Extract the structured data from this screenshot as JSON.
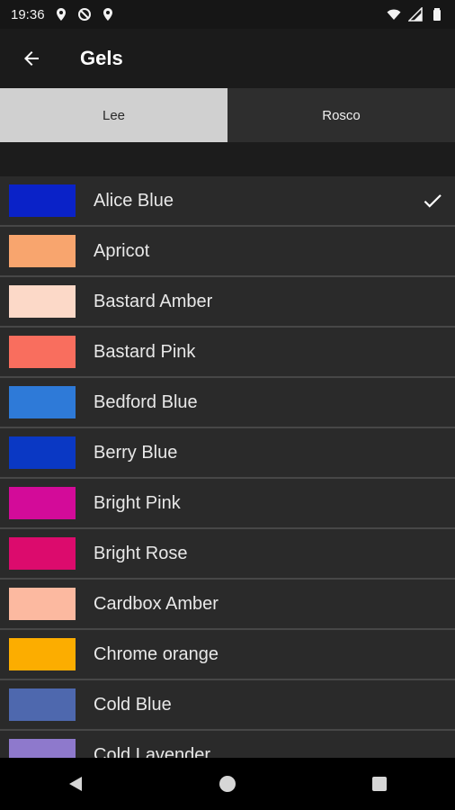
{
  "status_bar": {
    "time": "19:36",
    "icons_left": [
      "location-icon",
      "do-not-disturb-icon",
      "location-icon"
    ],
    "icons_right": [
      "wifi-icon",
      "signal-icon",
      "battery-icon"
    ]
  },
  "app_bar": {
    "title": "Gels",
    "back_icon": "arrow-left-icon"
  },
  "tabs": [
    {
      "label": "Lee",
      "selected": true
    },
    {
      "label": "Rosco",
      "selected": false
    }
  ],
  "gels": [
    {
      "name": "Alice Blue",
      "color": "#0a22c8",
      "selected": true
    },
    {
      "name": "Apricot",
      "color": "#f8a56e",
      "selected": false
    },
    {
      "name": "Bastard Amber",
      "color": "#fcd9c8",
      "selected": false
    },
    {
      "name": "Bastard Pink",
      "color": "#f96e5e",
      "selected": false
    },
    {
      "name": "Bedford Blue",
      "color": "#2e7ad8",
      "selected": false
    },
    {
      "name": "Berry Blue",
      "color": "#0a38c4",
      "selected": false
    },
    {
      "name": "Bright Pink",
      "color": "#d30b99",
      "selected": false
    },
    {
      "name": "Bright Rose",
      "color": "#dc0b6d",
      "selected": false
    },
    {
      "name": "Cardbox Amber",
      "color": "#fcb9a0",
      "selected": false
    },
    {
      "name": "Chrome orange",
      "color": "#fcad00",
      "selected": false
    },
    {
      "name": "Cold Blue",
      "color": "#4e68ae",
      "selected": false
    },
    {
      "name": "Cold Lavender",
      "color": "#8e79cc",
      "selected": false
    }
  ],
  "nav_bar": {
    "buttons": [
      "back-triangle-icon",
      "home-circle-icon",
      "recents-square-icon"
    ]
  }
}
